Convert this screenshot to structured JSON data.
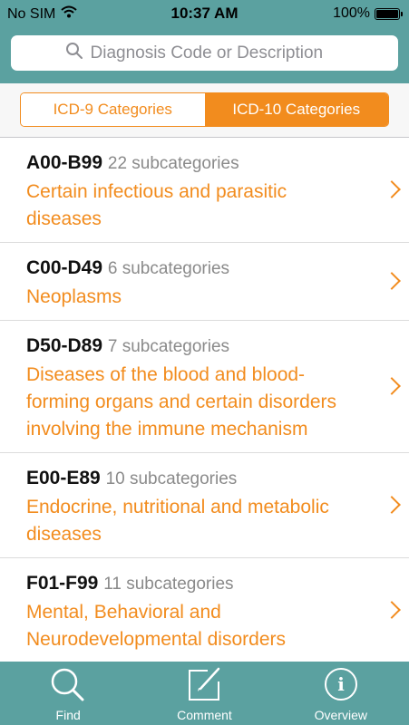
{
  "status": {
    "carrier": "No SIM",
    "time": "10:37 AM",
    "battery": "100%"
  },
  "search": {
    "placeholder": "Diagnosis Code or Description"
  },
  "segments": [
    {
      "label": "ICD-9 Categories",
      "selected": false
    },
    {
      "label": "ICD-10 Categories",
      "selected": true
    }
  ],
  "categories": [
    {
      "code": "A00-B99",
      "subcount": "22 subcategories",
      "description": "Certain infectious and parasitic diseases"
    },
    {
      "code": "C00-D49",
      "subcount": "6 subcategories",
      "description": "Neoplasms"
    },
    {
      "code": "D50-D89",
      "subcount": "7 subcategories",
      "description": "Diseases of the blood and blood-forming organs and certain disorders involving the immune mechanism"
    },
    {
      "code": "E00-E89",
      "subcount": "10 subcategories",
      "description": "Endocrine, nutritional and metabolic diseases"
    },
    {
      "code": "F01-F99",
      "subcount": "11 subcategories",
      "description": "Mental, Behavioral and Neurodevelopmental disorders"
    }
  ],
  "tabs": [
    {
      "label": "Find",
      "icon": "magnifier-icon"
    },
    {
      "label": "Comment",
      "icon": "compose-icon"
    },
    {
      "label": "Overview",
      "icon": "info-icon"
    }
  ],
  "colors": {
    "teal": "#5ba1a0",
    "accent": "#f28c1e"
  }
}
